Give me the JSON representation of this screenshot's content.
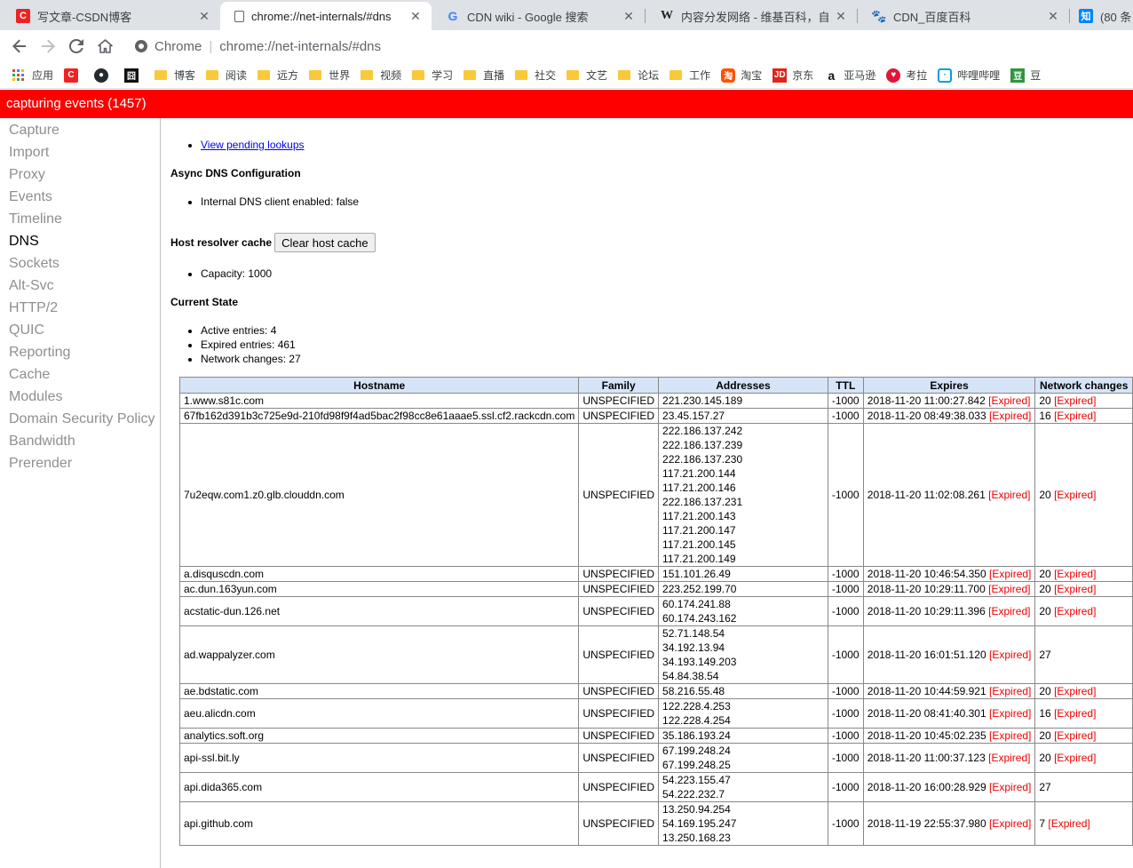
{
  "tabs": [
    {
      "title": "写文章-CSDN博客",
      "icon": "csdn-icon",
      "active": false
    },
    {
      "title": "chrome://net-internals/#dns",
      "icon": "page-icon",
      "active": true
    },
    {
      "title": "CDN wiki - Google 搜索",
      "icon": "google-icon",
      "active": false
    },
    {
      "title": "内容分发网络 - 维基百科，自由的",
      "icon": "wikipedia-icon",
      "active": false
    },
    {
      "title": "CDN_百度百科",
      "icon": "baidu-icon",
      "active": false
    },
    {
      "title": "(80 条",
      "icon": "zhihu-icon",
      "active": false
    }
  ],
  "omnibox": {
    "chip": "Chrome",
    "url": "chrome://net-internals/#dns"
  },
  "bookmarks": {
    "apps_label": "应用",
    "items": [
      "博客",
      "阅读",
      "远方",
      "世界",
      "视频",
      "学习",
      "直播",
      "社交",
      "文艺",
      "论坛",
      "工作",
      "淘宝",
      "京东",
      "亚马逊",
      "考拉",
      "哔哩哔哩",
      "豆"
    ]
  },
  "status": {
    "text": "capturing events (1457)",
    "color": "#ff0000"
  },
  "sidebar": {
    "items": [
      "Capture",
      "Import",
      "Proxy",
      "Events",
      "Timeline",
      "DNS",
      "Sockets",
      "Alt-Svc",
      "HTTP/2",
      "QUIC",
      "Reporting",
      "Cache",
      "Modules",
      "Domain Security Policy",
      "Bandwidth",
      "Prerender"
    ],
    "selected": "DNS"
  },
  "content": {
    "pending_link": "View pending lookups",
    "async_heading": "Async DNS Configuration",
    "async_item": "Internal DNS client enabled: false",
    "resolver_heading": "Host resolver cache",
    "clear_button": "Clear host cache",
    "capacity": "Capacity: 1000",
    "state_heading": "Current State",
    "state_items": [
      "Active entries: 4",
      "Expired entries: 461",
      "Network changes: 27"
    ]
  },
  "table": {
    "headers": [
      "Hostname",
      "Family",
      "Addresses",
      "TTL",
      "Expires",
      "Network changes"
    ],
    "expired_label": "[Expired]",
    "rows": [
      {
        "host": "1.www.s81c.com",
        "family": "UNSPECIFIED",
        "addresses": [
          "221.230.145.189"
        ],
        "ttl": "-1000",
        "expires": "2018-11-20 11:00:27.842",
        "expires_expired": true,
        "changes": "20",
        "changes_expired": true
      },
      {
        "host": "67fb162d391b3c725e9d-210fd98f9f4ad5bac2f98cc8e61aaae5.ssl.cf2.rackcdn.com",
        "family": "UNSPECIFIED",
        "addresses": [
          "23.45.157.27"
        ],
        "ttl": "-1000",
        "expires": "2018-11-20 08:49:38.033",
        "expires_expired": true,
        "changes": "16",
        "changes_expired": true
      },
      {
        "host": "7u2eqw.com1.z0.glb.clouddn.com",
        "family": "UNSPECIFIED",
        "addresses": [
          "222.186.137.242",
          "222.186.137.239",
          "222.186.137.230",
          "117.21.200.144",
          "117.21.200.146",
          "222.186.137.231",
          "117.21.200.143",
          "117.21.200.147",
          "117.21.200.145",
          "117.21.200.149"
        ],
        "ttl": "-1000",
        "expires": "2018-11-20 11:02:08.261",
        "expires_expired": true,
        "changes": "20",
        "changes_expired": true
      },
      {
        "host": "a.disquscdn.com",
        "family": "UNSPECIFIED",
        "addresses": [
          "151.101.26.49"
        ],
        "ttl": "-1000",
        "expires": "2018-11-20 10:46:54.350",
        "expires_expired": true,
        "changes": "20",
        "changes_expired": true
      },
      {
        "host": "ac.dun.163yun.com",
        "family": "UNSPECIFIED",
        "addresses": [
          "223.252.199.70"
        ],
        "ttl": "-1000",
        "expires": "2018-11-20 10:29:11.700",
        "expires_expired": true,
        "changes": "20",
        "changes_expired": true
      },
      {
        "host": "acstatic-dun.126.net",
        "family": "UNSPECIFIED",
        "addresses": [
          "60.174.241.88",
          "60.174.243.162"
        ],
        "ttl": "-1000",
        "expires": "2018-11-20 10:29:11.396",
        "expires_expired": true,
        "changes": "20",
        "changes_expired": true
      },
      {
        "host": "ad.wappalyzer.com",
        "family": "UNSPECIFIED",
        "addresses": [
          "52.71.148.54",
          "34.192.13.94",
          "34.193.149.203",
          "54.84.38.54"
        ],
        "ttl": "-1000",
        "expires": "2018-11-20 16:01:51.120",
        "expires_expired": true,
        "changes": "27",
        "changes_expired": false
      },
      {
        "host": "ae.bdstatic.com",
        "family": "UNSPECIFIED",
        "addresses": [
          "58.216.55.48"
        ],
        "ttl": "-1000",
        "expires": "2018-11-20 10:44:59.921",
        "expires_expired": true,
        "changes": "20",
        "changes_expired": true
      },
      {
        "host": "aeu.alicdn.com",
        "family": "UNSPECIFIED",
        "addresses": [
          "122.228.4.253",
          "122.228.4.254"
        ],
        "ttl": "-1000",
        "expires": "2018-11-20 08:41:40.301",
        "expires_expired": true,
        "changes": "16",
        "changes_expired": true
      },
      {
        "host": "analytics.soft.org",
        "family": "UNSPECIFIED",
        "addresses": [
          "35.186.193.24"
        ],
        "ttl": "-1000",
        "expires": "2018-11-20 10:45:02.235",
        "expires_expired": true,
        "changes": "20",
        "changes_expired": true
      },
      {
        "host": "api-ssl.bit.ly",
        "family": "UNSPECIFIED",
        "addresses": [
          "67.199.248.24",
          "67.199.248.25"
        ],
        "ttl": "-1000",
        "expires": "2018-11-20 11:00:37.123",
        "expires_expired": true,
        "changes": "20",
        "changes_expired": true
      },
      {
        "host": "api.dida365.com",
        "family": "UNSPECIFIED",
        "addresses": [
          "54.223.155.47",
          "54.222.232.7"
        ],
        "ttl": "-1000",
        "expires": "2018-11-20 16:00:28.929",
        "expires_expired": true,
        "changes": "27",
        "changes_expired": false
      },
      {
        "host": "api.github.com",
        "family": "UNSPECIFIED",
        "addresses": [
          "13.250.94.254",
          "54.169.195.247",
          "13.250.168.23"
        ],
        "ttl": "-1000",
        "expires": "2018-11-19 22:55:37.980",
        "expires_expired": true,
        "changes": "7",
        "changes_expired": true
      }
    ]
  }
}
